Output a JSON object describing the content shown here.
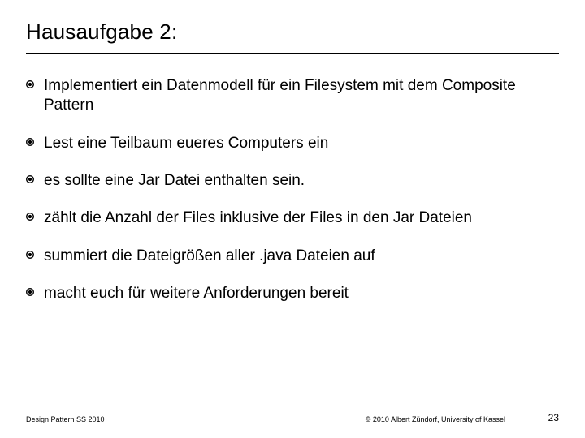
{
  "title": "Hausaufgabe 2:",
  "bullets": [
    "Implementiert ein Datenmodell für ein Filesystem mit dem Composite Pattern",
    "Lest eine Teilbaum eueres Computers ein",
    "es sollte eine Jar Datei enthalten sein.",
    "zählt die Anzahl der Files inklusive der Files in den Jar Dateien",
    "summiert die Dateigrößen aller .java Dateien auf",
    "macht euch für weitere Anforderungen bereit"
  ],
  "footer": {
    "left": "Design Pattern SS 2010",
    "center": "© 2010 Albert Zündorf, University of Kassel",
    "page": "23"
  }
}
